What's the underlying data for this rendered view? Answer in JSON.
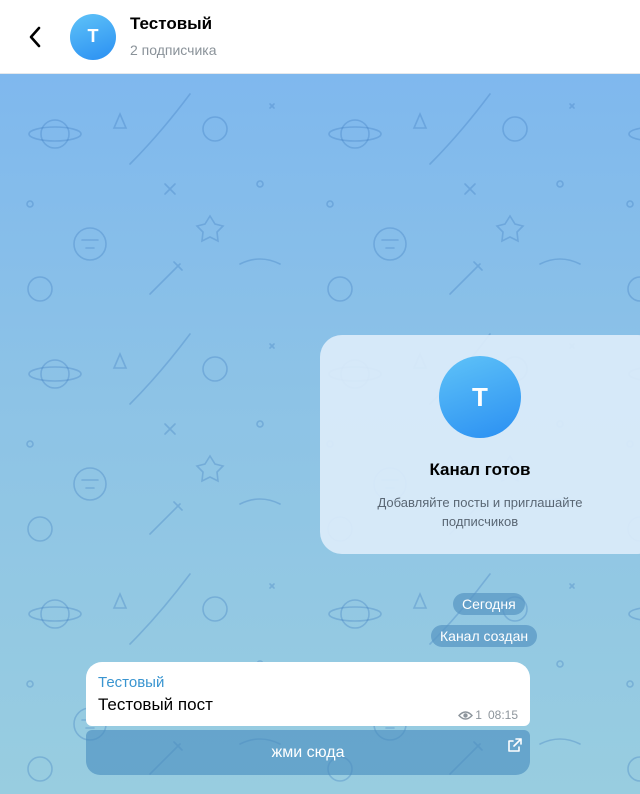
{
  "header": {
    "title": "Тестовый",
    "subtitle": "2 подписчика",
    "avatar_letter": "T",
    "back_icon": "chevron-left-icon"
  },
  "info_card": {
    "avatar_letter": "T",
    "title": "Канал готов",
    "description": "Добавляйте посты и приглашайте подписчиков"
  },
  "service": {
    "date": "Сегодня",
    "created": "Канал создан"
  },
  "message": {
    "author": "Тестовый",
    "text": "Тестовый пост",
    "views": "1",
    "time": "08:15",
    "views_icon": "eye-icon"
  },
  "inline_button": {
    "label": "жми сюда",
    "icon": "external-link-icon"
  },
  "colors": {
    "accent": "#3a95d0",
    "avatar_gradient_start": "#5fc3f8",
    "avatar_gradient_end": "#2a8ff2"
  }
}
